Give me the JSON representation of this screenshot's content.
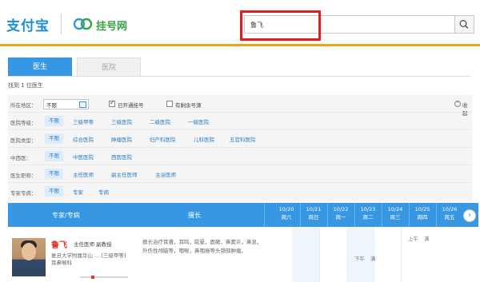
{
  "header": {
    "logo_alipay": "支付宝",
    "logo_site": "挂号网"
  },
  "search": {
    "query": "鲁飞"
  },
  "tabs": {
    "doctor": "医生",
    "hospital": "医院"
  },
  "result": {
    "found_text": "找到 1 位医生"
  },
  "filters": {
    "region_label": "所在地区：",
    "region_value": "不限",
    "opened_label": "已开通挂号",
    "remaining_label": "有剩余号源",
    "collapse_label": "收起",
    "level": {
      "label": "医院等级：",
      "options": [
        "不限",
        "三级甲等",
        "三级医院",
        "二级医院",
        "一级医院"
      ]
    },
    "type": {
      "label": "医院类型：",
      "options": [
        "不限",
        "综合医院",
        "肿瘤医院",
        "妇产科医院",
        "儿科医院",
        "五官科医院"
      ]
    },
    "tcm": {
      "label": "中西医：",
      "options": [
        "不限",
        "中医医院",
        "西医医院"
      ]
    },
    "position": {
      "label": "医生职称：",
      "options": [
        "不限",
        "主任医师",
        "副主任医师",
        "主治医师"
      ]
    },
    "expert": {
      "label": "专家专病：",
      "options": [
        "不限",
        "专家",
        "专病"
      ]
    }
  },
  "schedule": {
    "col_doctor": "专家/专病",
    "col_specialty": "擅长",
    "days": [
      {
        "date": "10/20",
        "weekday": "周六"
      },
      {
        "date": "10/21",
        "weekday": "周日"
      },
      {
        "date": "10/22",
        "weekday": "周一"
      },
      {
        "date": "10/23",
        "weekday": "周二"
      },
      {
        "date": "10/24",
        "weekday": "周三"
      },
      {
        "date": "10/25",
        "weekday": "周四"
      },
      {
        "date": "10/26",
        "weekday": "周五"
      }
    ]
  },
  "doctor": {
    "name": "鲁飞",
    "title": "主任医师 副教授",
    "hospital_line1": "复旦大学附属华山 ... [三级甲等]",
    "hospital_line2": "耳鼻喉科",
    "specialty": "擅长治疗耳聋，耳鸣，眩晕，面瘫，鼻窦炎，鼻息，外伤性颅脑等，咽喉，鼻咽癌等头颈部肿瘤。",
    "slot_am": "上午",
    "slot_pm": "下午",
    "slot_status": "满"
  },
  "colors": {
    "accent_blue": "#3897e3",
    "brand_orange": "#f5a114",
    "highlight_red": "#e21d23",
    "name_red": "#e2342b"
  }
}
